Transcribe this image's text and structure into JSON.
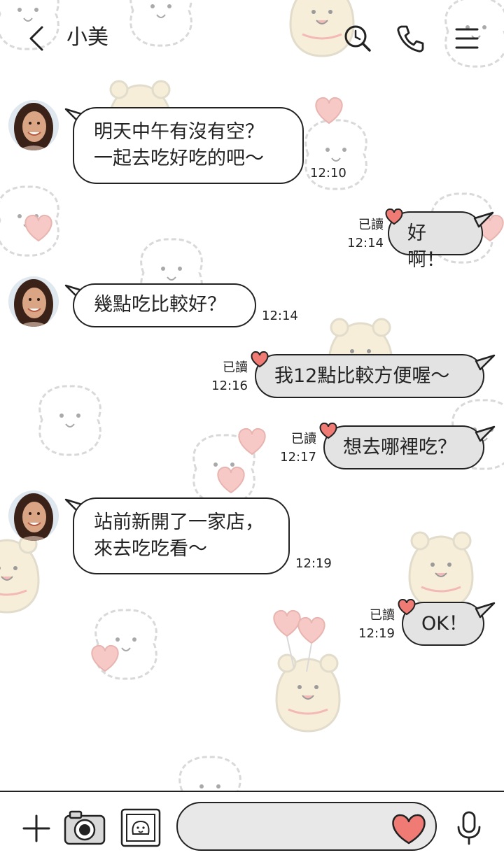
{
  "header": {
    "title": "小美",
    "icons": [
      "back-chevron-icon",
      "search-history-icon",
      "phone-icon",
      "menu-icon"
    ]
  },
  "messages": [
    {
      "side": "in",
      "text": "明天中午有沒有空？\n一起去吃好吃的吧～",
      "time": "12:10"
    },
    {
      "side": "out",
      "text": "好啊！",
      "read": "已讀",
      "time": "12:14"
    },
    {
      "side": "in",
      "text": "幾點吃比較好？",
      "time": "12:14"
    },
    {
      "side": "out",
      "text": "我12點比較方便喔～",
      "read": "已讀",
      "time": "12:16"
    },
    {
      "side": "out",
      "text": "想去哪裡吃？",
      "read": "已讀",
      "time": "12:17"
    },
    {
      "side": "in",
      "text": "站前新開了一家店，\n來去吃吃看～",
      "time": "12:19"
    },
    {
      "side": "out",
      "text": "OK！",
      "read": "已讀",
      "time": "12:19"
    }
  ],
  "input_bar": {
    "icons": [
      "plus-icon",
      "camera-icon",
      "photo-icon",
      "heart-emoji-icon",
      "microphone-icon"
    ],
    "placeholder": ""
  },
  "colors": {
    "bubble_out": "#e3e3e3",
    "heart": "#f07a74",
    "bear": "#f6eed8"
  }
}
